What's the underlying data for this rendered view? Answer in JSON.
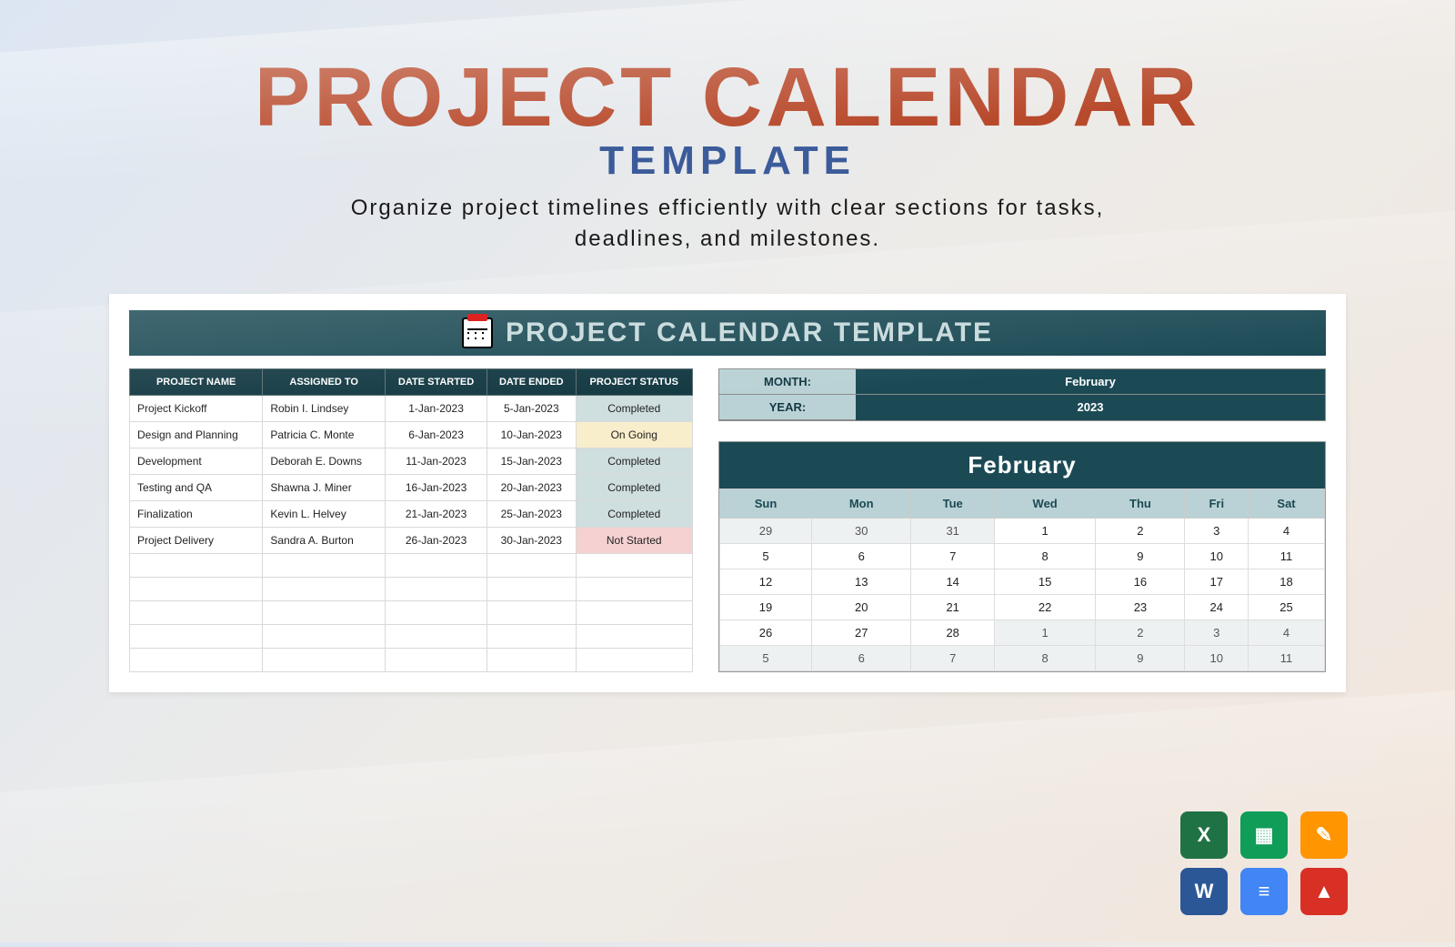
{
  "header": {
    "title": "PROJECT CALENDAR",
    "subtitle": "TEMPLATE",
    "description_line1": "Organize project timelines efficiently with clear sections for tasks,",
    "description_line2": "deadlines, and milestones."
  },
  "template": {
    "banner_title": "PROJECT CALENDAR TEMPLATE",
    "columns": {
      "project_name": "PROJECT NAME",
      "assigned_to": "ASSIGNED TO",
      "date_started": "DATE STARTED",
      "date_ended": "DATE ENDED",
      "project_status": "PROJECT STATUS"
    },
    "rows": [
      {
        "name": "Project Kickoff",
        "assigned": "Robin I. Lindsey",
        "start": "1-Jan-2023",
        "end": "5-Jan-2023",
        "status": "Completed",
        "class": "status-completed"
      },
      {
        "name": "Design and Planning",
        "assigned": "Patricia C. Monte",
        "start": "6-Jan-2023",
        "end": "10-Jan-2023",
        "status": "On Going",
        "class": "status-ongoing"
      },
      {
        "name": "Development",
        "assigned": "Deborah E. Downs",
        "start": "11-Jan-2023",
        "end": "15-Jan-2023",
        "status": "Completed",
        "class": "status-completed"
      },
      {
        "name": "Testing and QA",
        "assigned": "Shawna J. Miner",
        "start": "16-Jan-2023",
        "end": "20-Jan-2023",
        "status": "Completed",
        "class": "status-completed"
      },
      {
        "name": "Finalization",
        "assigned": "Kevin L. Helvey",
        "start": "21-Jan-2023",
        "end": "25-Jan-2023",
        "status": "Completed",
        "class": "status-completed"
      },
      {
        "name": "Project Delivery",
        "assigned": "Sandra A. Burton",
        "start": "26-Jan-2023",
        "end": "30-Jan-2023",
        "status": "Not Started",
        "class": "status-notstarted"
      }
    ]
  },
  "monthyear": {
    "month_label": "MONTH:",
    "month_value": "February",
    "year_label": "YEAR:",
    "year_value": "2023"
  },
  "calendar": {
    "title": "February",
    "days": [
      "Sun",
      "Mon",
      "Tue",
      "Wed",
      "Thu",
      "Fri",
      "Sat"
    ],
    "weeks": [
      [
        {
          "d": "29",
          "prev": true
        },
        {
          "d": "30",
          "prev": true
        },
        {
          "d": "31",
          "prev": true
        },
        {
          "d": "1"
        },
        {
          "d": "2"
        },
        {
          "d": "3"
        },
        {
          "d": "4"
        }
      ],
      [
        {
          "d": "5"
        },
        {
          "d": "6"
        },
        {
          "d": "7"
        },
        {
          "d": "8"
        },
        {
          "d": "9"
        },
        {
          "d": "10"
        },
        {
          "d": "11"
        }
      ],
      [
        {
          "d": "12"
        },
        {
          "d": "13"
        },
        {
          "d": "14"
        },
        {
          "d": "15"
        },
        {
          "d": "16"
        },
        {
          "d": "17"
        },
        {
          "d": "18"
        }
      ],
      [
        {
          "d": "19"
        },
        {
          "d": "20"
        },
        {
          "d": "21"
        },
        {
          "d": "22"
        },
        {
          "d": "23"
        },
        {
          "d": "24"
        },
        {
          "d": "25"
        }
      ],
      [
        {
          "d": "26"
        },
        {
          "d": "27"
        },
        {
          "d": "28"
        },
        {
          "d": "1",
          "prev": true
        },
        {
          "d": "2",
          "prev": true
        },
        {
          "d": "3",
          "prev": true
        },
        {
          "d": "4",
          "prev": true
        }
      ],
      [
        {
          "d": "5",
          "prev": true
        },
        {
          "d": "6",
          "prev": true
        },
        {
          "d": "7",
          "prev": true
        },
        {
          "d": "8",
          "prev": true
        },
        {
          "d": "9",
          "prev": true
        },
        {
          "d": "10",
          "prev": true
        },
        {
          "d": "11",
          "prev": true
        }
      ]
    ]
  },
  "apps": {
    "excel": "X",
    "sheets": "▦",
    "pages": "✎",
    "word": "W",
    "docs": "≡",
    "pdf": "▲"
  }
}
